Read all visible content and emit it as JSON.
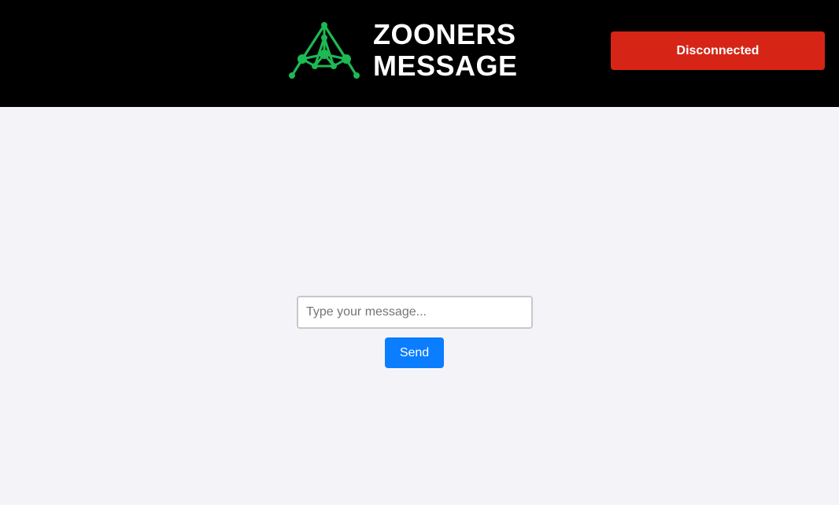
{
  "header": {
    "brand": {
      "line1": "ZOONERS",
      "line2": "MESSAGE",
      "logo_icon": "network-triangle-icon",
      "logo_color": "#1db954"
    },
    "connection_status": {
      "label": "Disconnected",
      "color": "#d62516"
    }
  },
  "composer": {
    "placeholder": "Type your message...",
    "value": "",
    "send_label": "Send",
    "send_color": "#0b7dff"
  },
  "colors": {
    "header_background": "#000000",
    "page_background": "#f4f4f8"
  }
}
